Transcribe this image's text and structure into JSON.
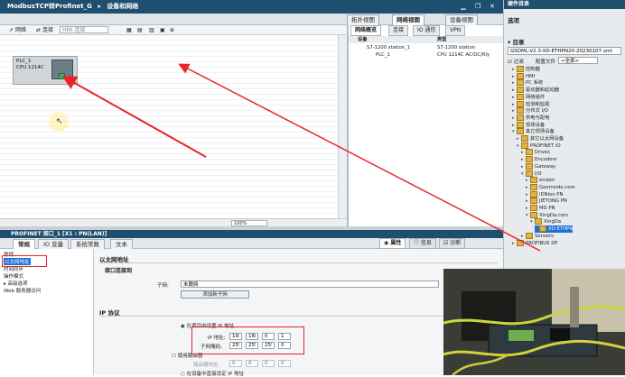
{
  "titlebar": {
    "project": "ModbusTCP转Profinet_G",
    "separator": "▸",
    "view": "设备和网络"
  },
  "view_tabs": {
    "topology": "拓扑视图",
    "network": "网络视图",
    "device": "设备视图"
  },
  "toolbar": {
    "network_btn": "网络",
    "connect_btn": "连接",
    "connect_type": "HMI 连接",
    "zoom_icon": "⊕"
  },
  "plc": {
    "name": "PLC_1",
    "model": "CPU 1214C"
  },
  "zoom": {
    "level": "100%"
  },
  "network_panel": {
    "tabs": [
      "网络概览",
      "连接",
      "IO 通信",
      "VPN"
    ],
    "columns": {
      "device": "设备",
      "type": "类型"
    },
    "rows": [
      {
        "device": "S7-1200 station_1",
        "type": "S7-1200 station"
      },
      {
        "device": "PLC_1",
        "type": "CPU 1214C AC/DC/Rly"
      }
    ]
  },
  "properties": {
    "title": "PROFINET 接口_1 [X1 : PN(LAN)]",
    "right_tabs": [
      "属性",
      "信息",
      "诊断"
    ],
    "tabs": [
      "常规",
      "IO 变量",
      "系统常数",
      "文本"
    ],
    "nav": [
      "常规",
      "以太网地址",
      "时间同步",
      "操作模式",
      "高级选项",
      "Web 服务器访问"
    ],
    "section_ethernet": "以太网地址",
    "subsection_interface": "接口连接到",
    "subnet_label": "子网:",
    "subnet_value": "未联网",
    "add_subnet": "添加新子网",
    "ip_protocol": "IP 协议",
    "set_ip_option": "在项目中设置 IP 地址",
    "ip_label": "IP 地址:",
    "ip_value": [
      "192",
      "168",
      "0",
      "1"
    ],
    "mask_label": "子网掩码:",
    "mask_value": [
      "255",
      "255",
      "255",
      "0"
    ],
    "router_option": "使用路由器",
    "router_label": "路由器地址:",
    "router_value": [
      "0",
      "0",
      "0",
      "0"
    ],
    "other_option": "在设备中直接设定 IP 地址"
  },
  "side": {
    "options": "选项",
    "catalog_header": "硬件目录",
    "catalog": "目录",
    "filter_label": "过滤",
    "profile_label": "配置文件",
    "profile_value": "<全部>",
    "gsd_file": "GSDML-V2.3-XD-ETHPN20-20230107.xml",
    "tree": [
      "控制器",
      "HMI",
      "PC 系统",
      "驱动器和起动器",
      "网络组件",
      "检测和监视",
      "分布式 I/O",
      "供电与配电",
      "现场设备",
      "其它现场设备",
      "其它以太网设备",
      "PROFINET IO",
      "Drives",
      "Encoders",
      "Gateway",
      "I/O",
      "endalc",
      "Geomside.com",
      "iDNlon PN",
      "JIETONG PN",
      "MD PN",
      "XingDa.com",
      "XingDa",
      "XD-ETHPN",
      "Sensors",
      "PROFIBUS DP"
    ]
  }
}
